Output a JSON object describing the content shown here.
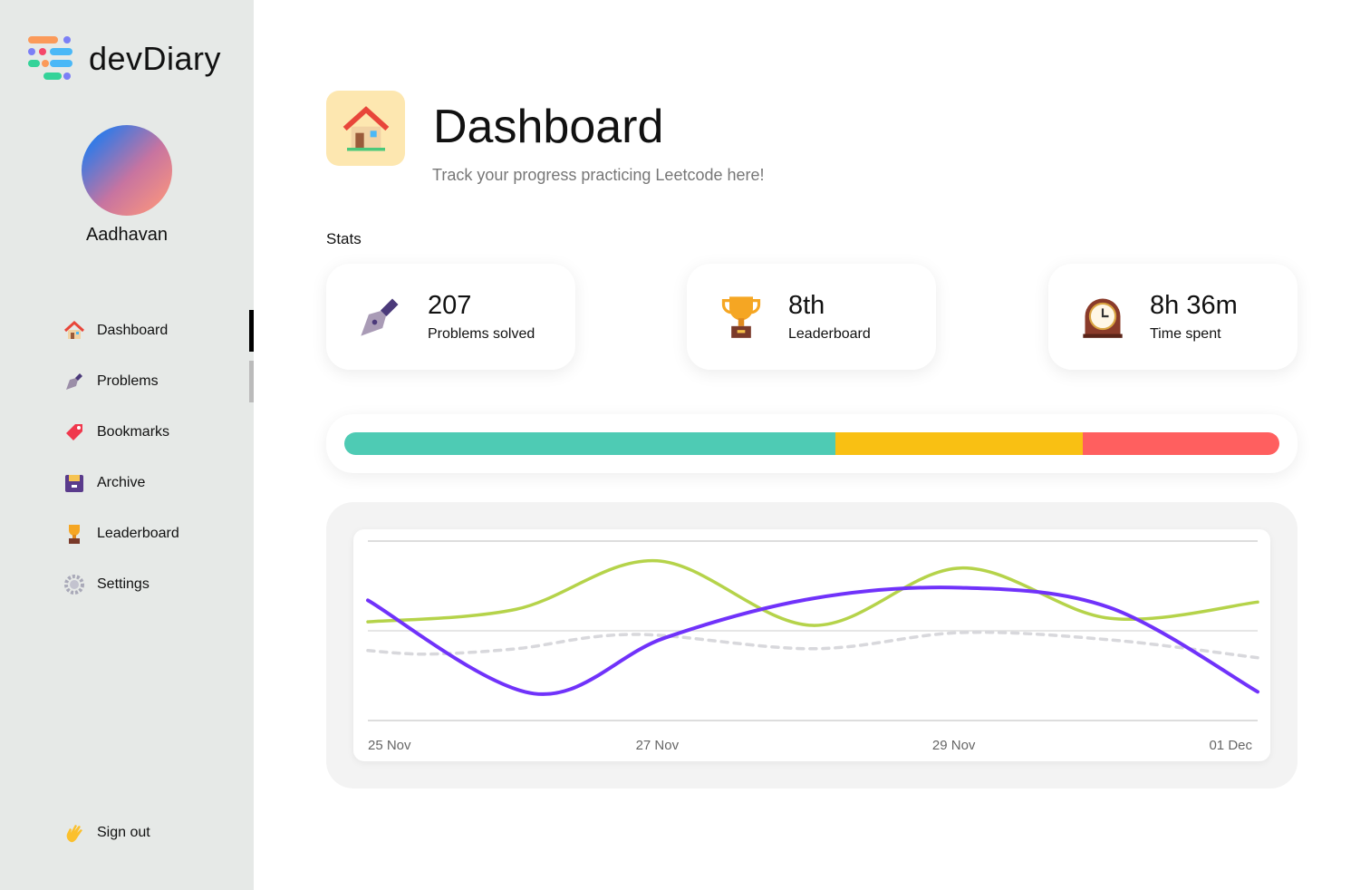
{
  "app": {
    "name": "devDiary"
  },
  "user": {
    "name": "Aadhavan"
  },
  "sidebar": {
    "items": [
      {
        "label": "Dashboard",
        "icon": "house-icon"
      },
      {
        "label": "Problems",
        "icon": "pen-icon"
      },
      {
        "label": "Bookmarks",
        "icon": "bookmark-icon"
      },
      {
        "label": "Archive",
        "icon": "archive-icon"
      },
      {
        "label": "Leaderboard",
        "icon": "trophy-icon"
      },
      {
        "label": "Settings",
        "icon": "gear-icon"
      }
    ],
    "signout": "Sign out"
  },
  "header": {
    "title": "Dashboard",
    "subtitle": "Track your progress practicing Leetcode here!"
  },
  "stats": {
    "label": "Stats",
    "cards": [
      {
        "value": "207",
        "label": "Problems solved",
        "icon": "pen-icon"
      },
      {
        "value": "8th",
        "label": "Leaderboard",
        "icon": "trophy-icon"
      },
      {
        "value": "8h 36m",
        "label": "Time spent",
        "icon": "clock-icon"
      }
    ]
  },
  "progress": {
    "segments": [
      {
        "percent": 52.5,
        "color": "#4ecbb4"
      },
      {
        "percent": 26.5,
        "color": "#f9c013"
      },
      {
        "percent": 21,
        "color": "#ff5f5f"
      }
    ]
  },
  "chart_data": {
    "type": "line",
    "x_ticks": [
      "25 Nov",
      "27 Nov",
      "29 Nov",
      "01 Dec"
    ],
    "xlim": [
      0,
      6
    ],
    "ylim": [
      0,
      100
    ],
    "grid": true,
    "series": [
      {
        "name": "green",
        "color": "#b5d34a",
        "dashed": false,
        "points": [
          [
            0,
            55
          ],
          [
            1,
            62
          ],
          [
            1.95,
            89
          ],
          [
            3,
            53
          ],
          [
            4,
            85
          ],
          [
            5,
            57
          ],
          [
            6,
            66
          ]
        ]
      },
      {
        "name": "grey",
        "color": "#d8d8dc",
        "dashed": true,
        "points": [
          [
            0,
            39
          ],
          [
            0.4,
            37
          ],
          [
            1,
            40
          ],
          [
            1.8,
            48
          ],
          [
            3,
            40
          ],
          [
            4,
            49
          ],
          [
            5,
            45
          ],
          [
            6,
            35
          ]
        ]
      },
      {
        "name": "purple",
        "color": "#7032fa",
        "dashed": false,
        "points": [
          [
            0,
            67
          ],
          [
            1.12,
            15
          ],
          [
            2,
            46
          ],
          [
            3,
            68
          ],
          [
            4,
            74
          ],
          [
            5,
            63
          ],
          [
            6,
            16
          ]
        ]
      }
    ]
  }
}
